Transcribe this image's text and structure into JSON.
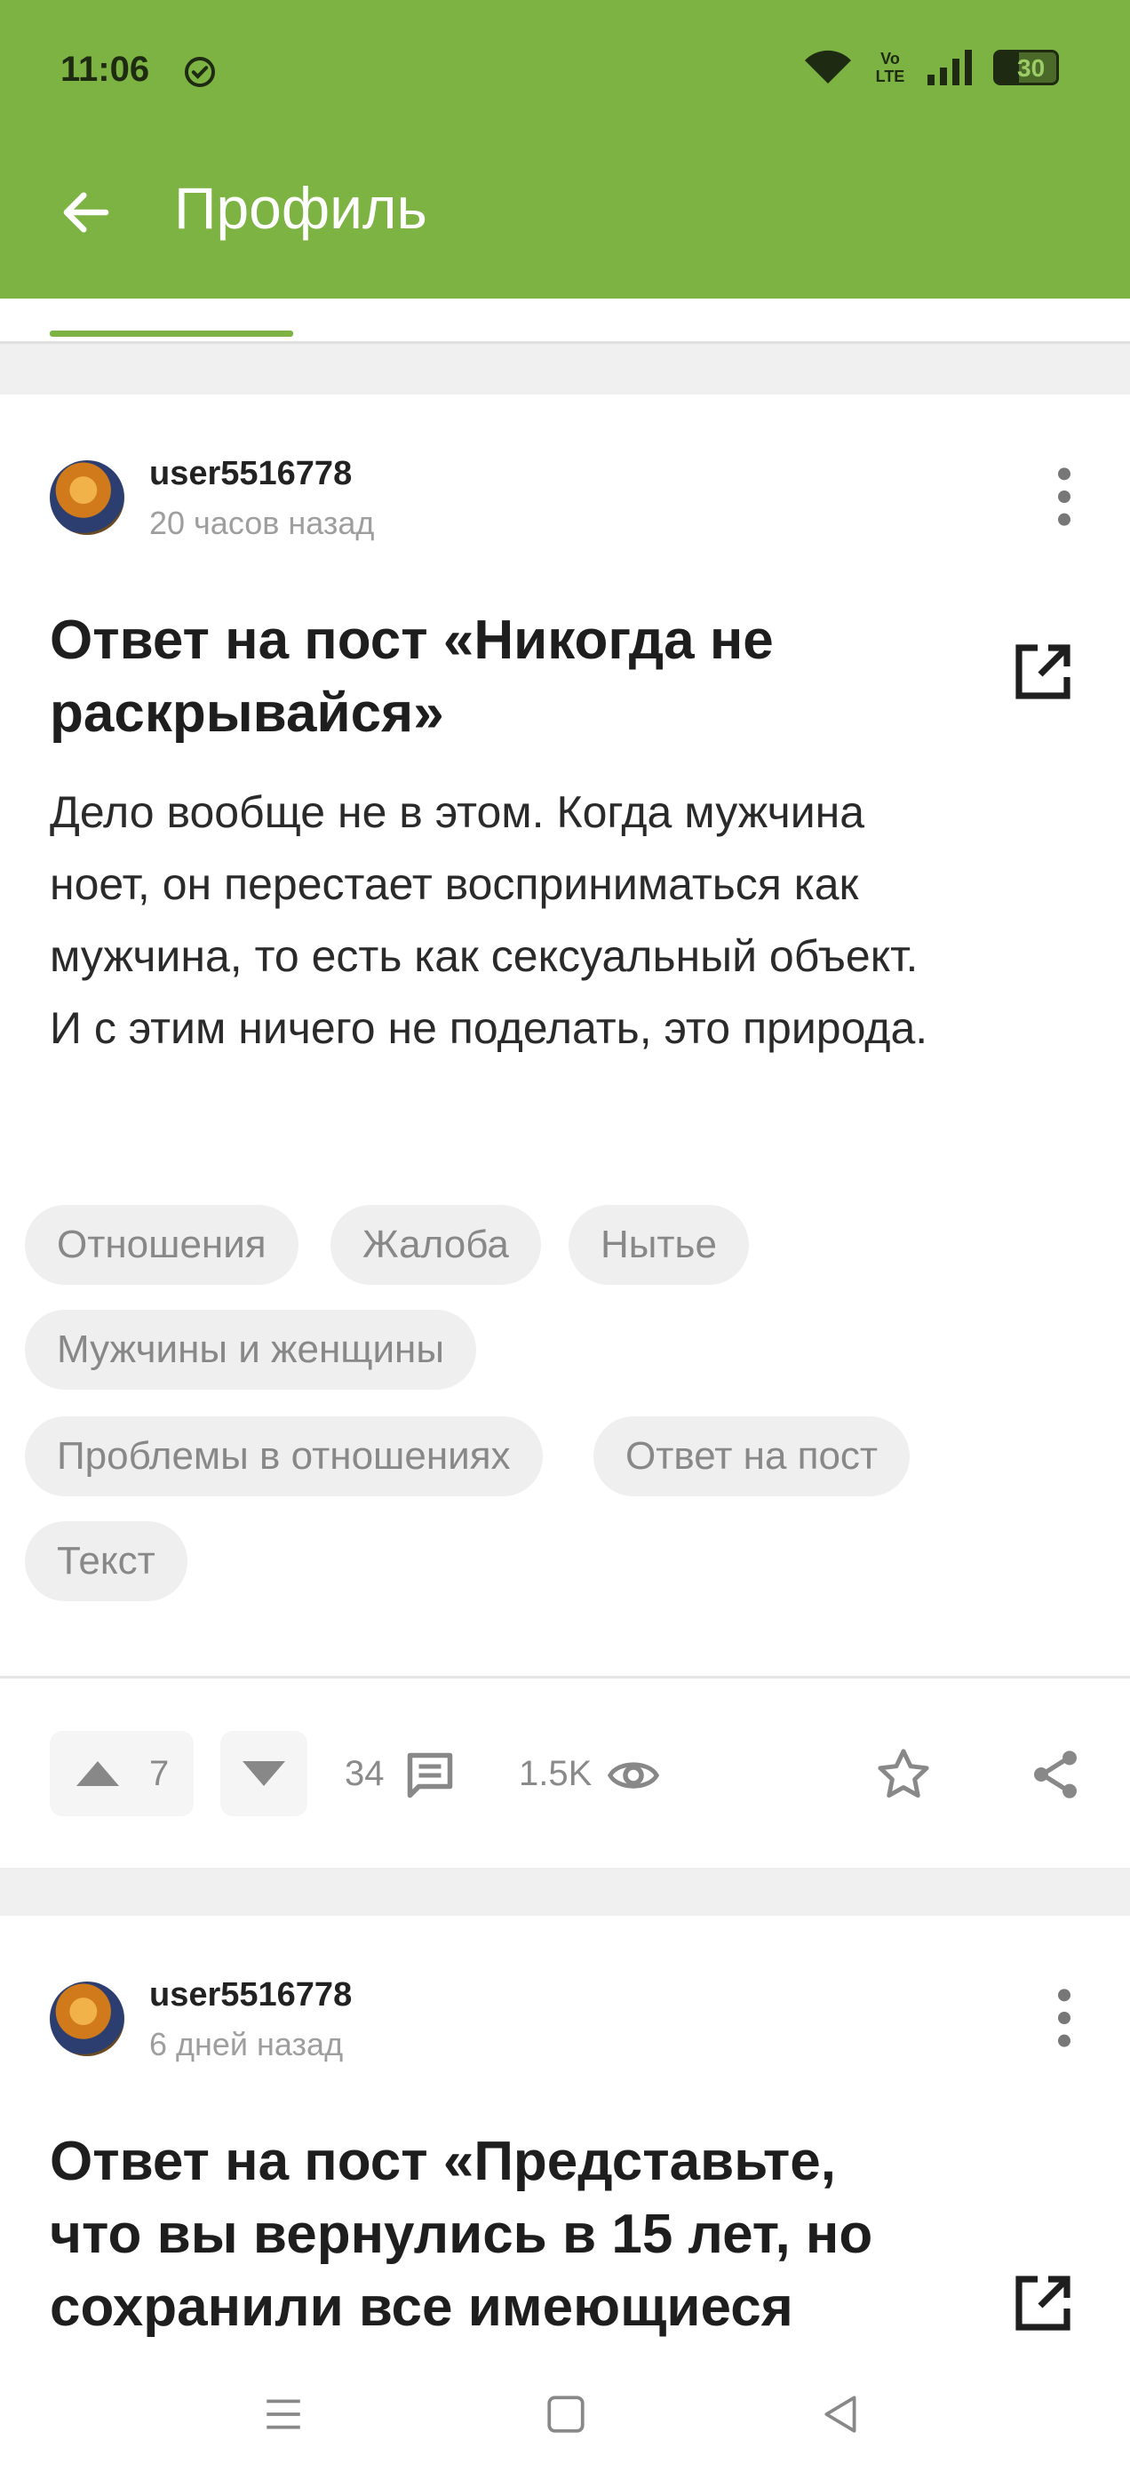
{
  "status_bar": {
    "time": "11:06",
    "battery": "30",
    "network": "Vo LTE"
  },
  "header": {
    "title": "Профиль"
  },
  "posts": [
    {
      "username": "user5516778",
      "time": "20 часов назад",
      "title_line1": "Ответ на пост «Никогда не",
      "title_line2": "раскрывайся»",
      "body_lines": [
        "Дело вообще не в этом. Когда мужчина",
        "ноет, он перестает восприниматься как",
        "мужчина, то есть как сексуальный объект.",
        "И с этим ничего не поделать, это природа."
      ],
      "tags": [
        "Отношения",
        "Жалоба",
        "Нытье",
        "Мужчины и женщины",
        "Проблемы в отношениях",
        "Ответ на пост",
        "Текст"
      ],
      "rating": "7",
      "comments": "34",
      "views": "1.5K"
    },
    {
      "username": "user5516778",
      "time": "6 дней назад",
      "title_lines": [
        "Ответ на пост «Представьте,",
        "что вы вернулись в 15 лет, но",
        "сохранили все имеющиеся"
      ]
    }
  ],
  "colors": {
    "accent": "#7cb342",
    "chip_bg": "#efefef",
    "muted": "#9e9e9e"
  },
  "icons": [
    "back-arrow-icon",
    "verified-check-icon",
    "wifi-icon",
    "signal-icon",
    "battery-icon",
    "more-vertical-icon",
    "external-link-icon",
    "upvote-icon",
    "downvote-icon",
    "comment-icon",
    "eye-icon",
    "star-icon",
    "share-icon",
    "menu-icon",
    "home-square-icon",
    "back-triangle-icon"
  ]
}
